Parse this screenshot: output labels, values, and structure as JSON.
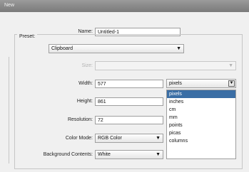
{
  "window": {
    "title": "New"
  },
  "name": {
    "label": "Name:",
    "value": "Untitled-1"
  },
  "preset": {
    "label": "Preset:",
    "value": "Clipboard"
  },
  "size": {
    "label": "Size:",
    "value": ""
  },
  "width": {
    "label": "Width:",
    "value": "577",
    "unit": "pixels"
  },
  "height": {
    "label": "Height:",
    "value": "861"
  },
  "resolution": {
    "label": "Resolution:",
    "value": "72"
  },
  "color_mode": {
    "label": "Color Mode:",
    "value": "RGB Color"
  },
  "background": {
    "label": "Background Contents:",
    "value": "White"
  },
  "unit_options": [
    "pixels",
    "inches",
    "cm",
    "mm",
    "points",
    "picas",
    "columns"
  ],
  "selected_unit": "pixels",
  "colors": {
    "titlebar": "#8a8a8a",
    "selection": "#3a6ea5",
    "panel": "#f0f0f0"
  }
}
